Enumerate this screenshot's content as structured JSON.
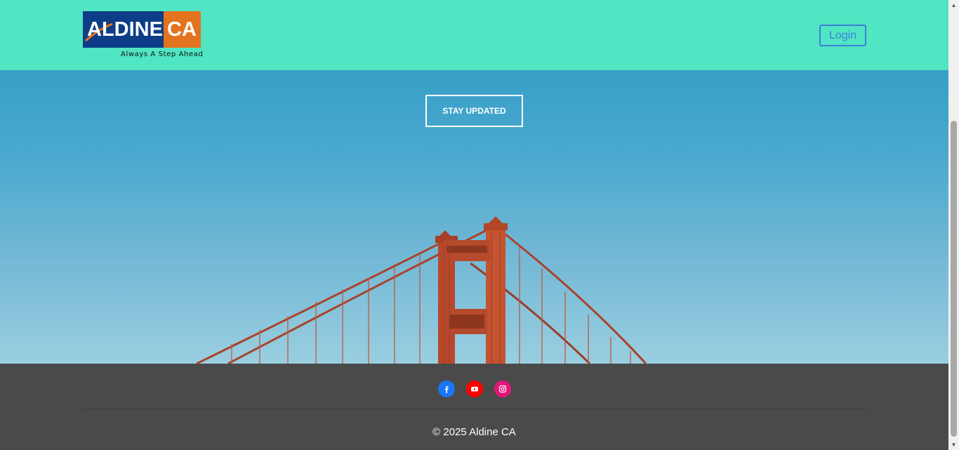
{
  "header": {
    "logo": {
      "text_left": "ALDINE",
      "text_right": "CA",
      "tagline": "Always A Step Ahead",
      "colors": {
        "blue": "#0d3d86",
        "orange": "#e3731f"
      }
    },
    "login_label": "Login",
    "background": "#50e5c3"
  },
  "hero": {
    "cta_label": "STAY UPDATED",
    "image": "golden-gate-bridge-tower"
  },
  "footer": {
    "socials": [
      {
        "name": "facebook-icon",
        "color": "#1877f2"
      },
      {
        "name": "youtube-icon",
        "color": "#ff0000"
      },
      {
        "name": "instagram-icon",
        "color": "#e4157a"
      }
    ],
    "copyright": "© 2025 Aldine CA"
  }
}
